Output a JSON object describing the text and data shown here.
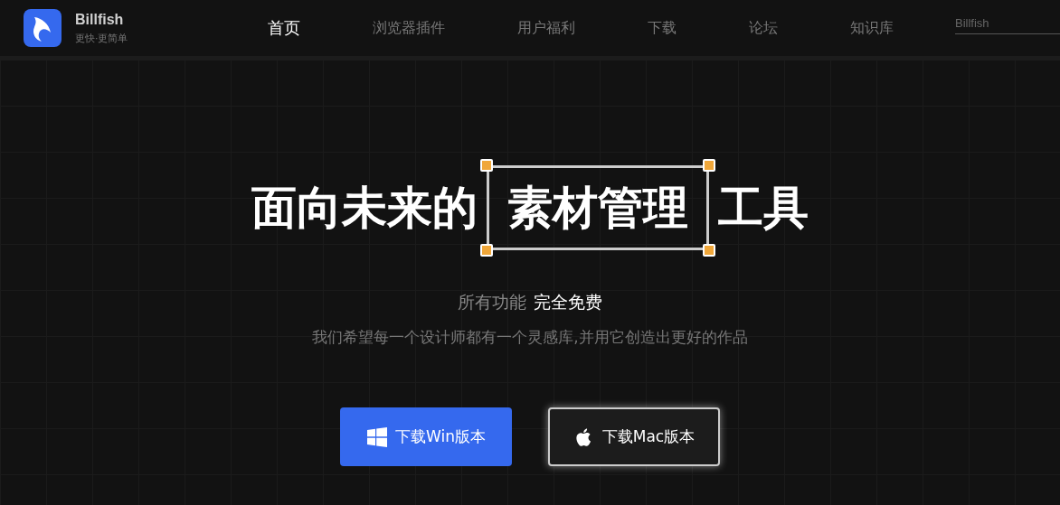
{
  "header": {
    "brand": "Billfish",
    "slogan": "更快·更简单",
    "nav": [
      {
        "label": "首页",
        "selected": true
      },
      {
        "label": "浏览器插件",
        "selected": false
      },
      {
        "label": "用户福利",
        "selected": false
      },
      {
        "label": "下载",
        "selected": false
      },
      {
        "label": "论坛",
        "selected": false
      },
      {
        "label": "知识库",
        "selected": false
      }
    ],
    "search": {
      "placeholder": "Billfish"
    }
  },
  "hero": {
    "headline": {
      "before": "面向未来的",
      "framed": "素材管理",
      "after": "工具"
    },
    "tagline": {
      "text": "所有功能",
      "highlight": "完全免费"
    },
    "description": "我们希望每一个设计师都有一个灵感库,并用它创造出更好的作品",
    "buttons": [
      {
        "kind": "windows",
        "label": "下载Win版本"
      },
      {
        "kind": "apple",
        "label": "下载Mac版本"
      }
    ]
  }
}
